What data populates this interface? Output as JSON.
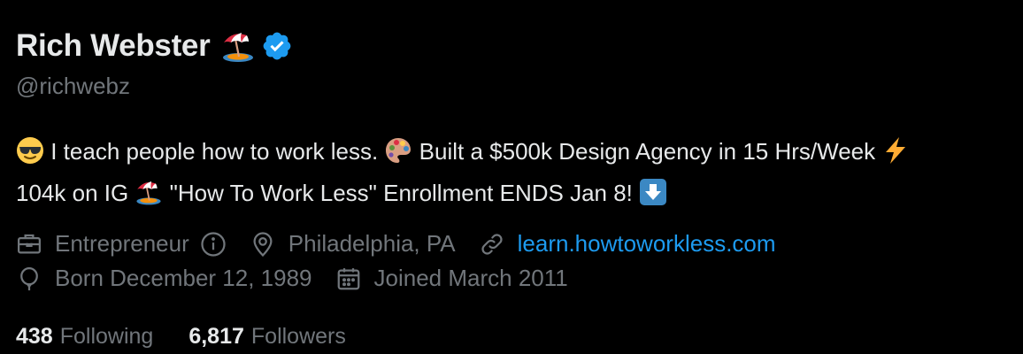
{
  "profile": {
    "name": "Rich Webster",
    "handle": "@richwebz",
    "name_emoji_icon": "beach-umbrella-icon",
    "verified_icon": "verified-badge-icon",
    "colors": {
      "background": "#000000",
      "text": "#e7e9ea",
      "muted": "#71767b",
      "link": "#1d9bf0",
      "verified": "#1d9bf0"
    }
  },
  "bio": {
    "segments": [
      {
        "icon": "sunglasses-face-icon"
      },
      {
        "text": " I teach people how to work less. "
      },
      {
        "icon": "artist-palette-icon"
      },
      {
        "text": " Built a $500k Design Agency in 15 Hrs/Week "
      },
      {
        "icon": "lightning-bolt-icon"
      },
      {
        "text": "104k on IG "
      },
      {
        "icon": "beach-umbrella-icon"
      },
      {
        "text": " \"How To Work Less\" Enrollment ENDS Jan 8! "
      },
      {
        "icon": "down-arrow-button-icon"
      }
    ],
    "text_1": " I teach people how to work less. ",
    "text_2": " Built a $500k Design Agency in 15 Hrs/Week ",
    "text_3": "104k on IG ",
    "text_4": " \"How To Work Less\" Enrollment ENDS Jan 8! "
  },
  "meta": {
    "profession": "Entrepreneur",
    "location": "Philadelphia, PA",
    "website": "learn.howtoworkless.com",
    "birthday": "Born December 12, 1989",
    "joined": "Joined March 2011"
  },
  "stats": {
    "following_count": "438",
    "following_label": "Following",
    "followers_count": "6,817",
    "followers_label": "Followers"
  }
}
